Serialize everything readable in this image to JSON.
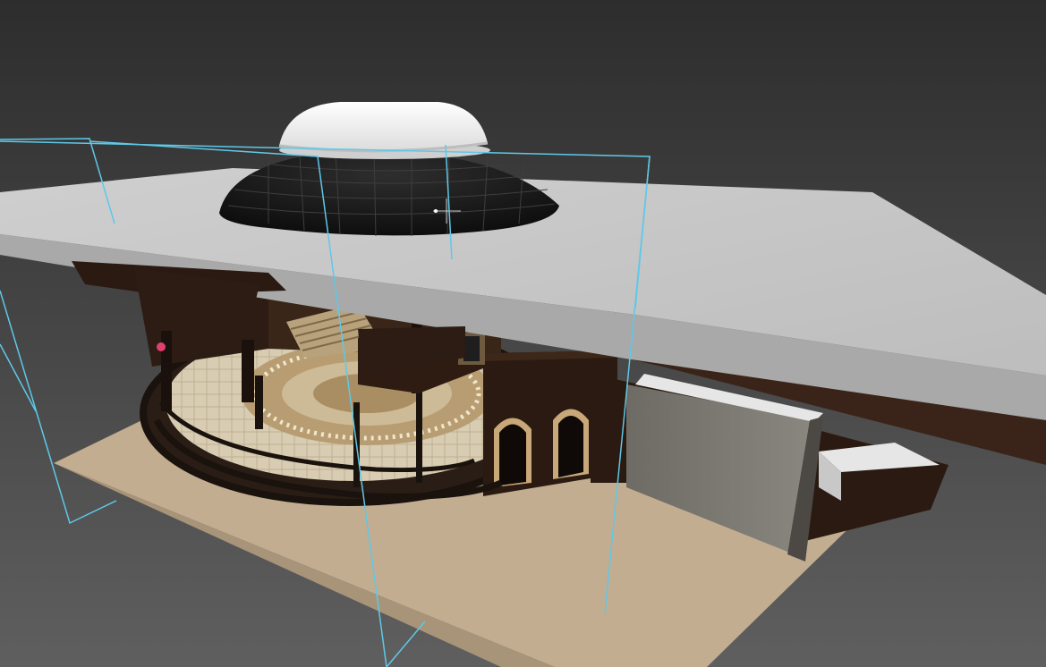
{
  "viewport": {
    "background_top": "#2d2d2d",
    "background_bottom": "#5f5f5f",
    "selection_color": "#5fc8e8",
    "floor_color": "#c2ad91",
    "ceiling_color": "#c9c9c9",
    "dome_color": "#191919",
    "skylight_color": "#ffffff",
    "wall_color": "#2a1a12",
    "marble_floor_color": "#d3c6ab",
    "arch_trim_color": "#c8a878"
  },
  "scene_objects": {
    "ceiling_slab": "ceiling-slab",
    "dome": "dome",
    "skylight": "skylight-cap",
    "floor": "floor-slab",
    "rotunda": "rotunda",
    "selection": "selection-bounding-box",
    "pivot": "pivot-gizmo"
  }
}
